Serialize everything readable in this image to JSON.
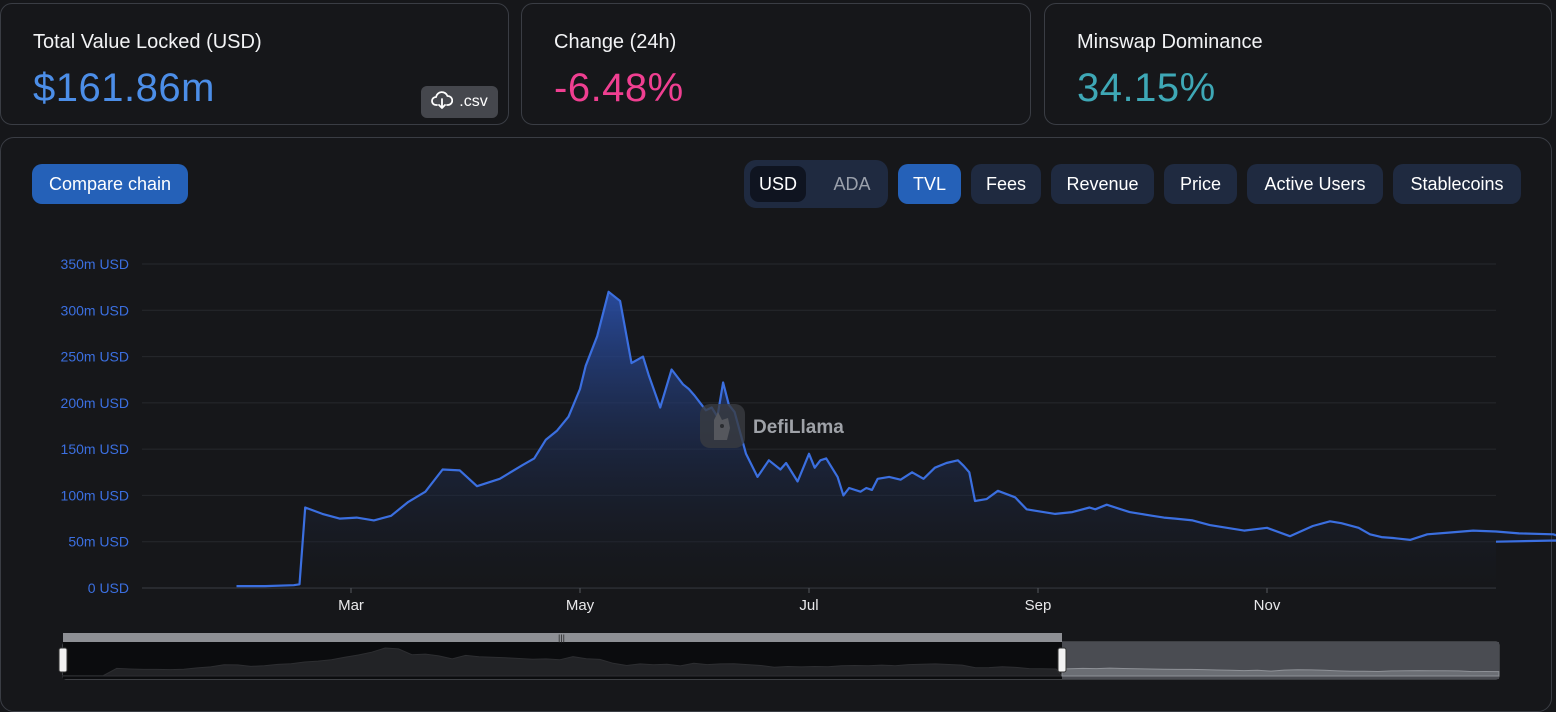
{
  "stats": {
    "tvl": {
      "label": "Total Value Locked (USD)",
      "value": "$161.86m",
      "color": "#4c8ee8",
      "csv_label": ".csv"
    },
    "change": {
      "label": "Change (24h)",
      "value": "-6.48%",
      "color": "#f03f91"
    },
    "dominance": {
      "label": "Minswap Dominance",
      "value": "34.15%",
      "color": "#3ea8b6"
    }
  },
  "controls": {
    "compare_label": "Compare chain",
    "currency": {
      "options": [
        "USD",
        "ADA"
      ],
      "selected": "USD"
    },
    "metrics": [
      "TVL",
      "Fees",
      "Revenue",
      "Price",
      "Active Users",
      "Stablecoins"
    ],
    "selected_metric": "TVL"
  },
  "watermark": "DefiLlama",
  "colors": {
    "line": "#3b6fe0",
    "accent": "#2561b8",
    "background": "#16171a"
  },
  "chart_data": {
    "type": "area",
    "xlabel": "",
    "ylabel": "",
    "ylim": [
      0,
      350
    ],
    "y_unit": "m USD",
    "y_ticks": [
      "0 USD",
      "50m USD",
      "100m USD",
      "150m USD",
      "200m USD",
      "250m USD",
      "300m USD",
      "350m USD"
    ],
    "x_ticks": [
      "Mar",
      "May",
      "Jul",
      "Sep",
      "Nov"
    ],
    "grid": true,
    "x_month": [
      0.0,
      0.25,
      0.5,
      0.55,
      0.6,
      0.75,
      0.9,
      1.05,
      1.2,
      1.35,
      1.5,
      1.65,
      1.8,
      1.95,
      2.1,
      2.3,
      2.5,
      2.6,
      2.7,
      2.8,
      2.9,
      3.0,
      3.05,
      3.15,
      3.25,
      3.35,
      3.45,
      3.55,
      3.6,
      3.7,
      3.8,
      3.9,
      3.95,
      4.0,
      4.05,
      4.1,
      4.15,
      4.2,
      4.25,
      4.3,
      4.35,
      4.45,
      4.55,
      4.65,
      4.75,
      4.8,
      4.9,
      5.0,
      5.05,
      5.1,
      5.15,
      5.2,
      5.25,
      5.3,
      5.35,
      5.45,
      5.5,
      5.55,
      5.6,
      5.7,
      5.8,
      5.9,
      6.0,
      6.1,
      6.2,
      6.3,
      6.35,
      6.4,
      6.45,
      6.55,
      6.65,
      6.8,
      6.9,
      7.0,
      7.15,
      7.3,
      7.45,
      7.5,
      7.6,
      7.7,
      7.8,
      7.9,
      8.0,
      8.1,
      8.2,
      8.35,
      8.5,
      8.65,
      8.8,
      9.0,
      9.2,
      9.4,
      9.55,
      9.65,
      9.8,
      9.9,
      10.0,
      10.1,
      10.25,
      10.4,
      10.6,
      10.8,
      11.0,
      11.2,
      11.5,
      11.7,
      11.8,
      11.9
    ],
    "values": [
      2,
      2,
      3,
      4,
      87,
      80,
      75,
      76,
      73,
      78,
      93,
      104,
      128,
      127,
      110,
      118,
      133,
      140,
      160,
      170,
      185,
      215,
      240,
      272,
      320,
      310,
      243,
      250,
      230,
      195,
      236,
      220,
      215,
      208,
      200,
      192,
      195,
      185,
      222,
      198,
      190,
      145,
      120,
      138,
      128,
      135,
      115,
      145,
      130,
      138,
      140,
      130,
      120,
      100,
      108,
      104,
      108,
      106,
      118,
      120,
      117,
      125,
      118,
      130,
      135,
      138,
      132,
      125,
      94,
      96,
      105,
      98,
      85,
      83,
      80,
      82,
      87,
      85,
      90,
      86,
      82,
      80,
      78,
      76,
      75,
      73,
      68,
      65,
      62,
      65,
      56,
      67,
      72,
      70,
      65,
      58,
      55,
      54,
      52,
      58,
      60,
      62,
      61,
      59,
      58,
      50,
      52,
      50
    ]
  }
}
